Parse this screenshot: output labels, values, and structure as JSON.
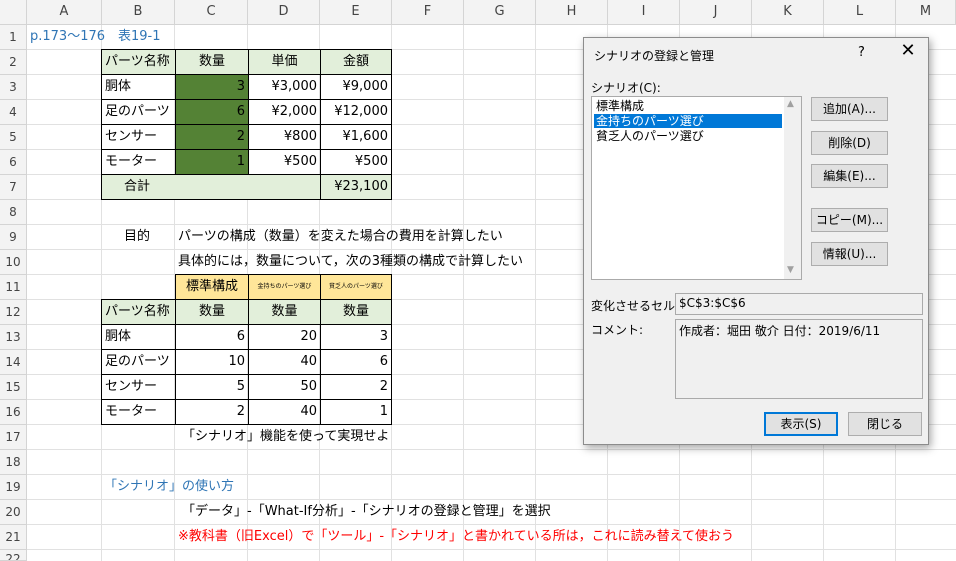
{
  "columns": [
    "A",
    "B",
    "C",
    "D",
    "E",
    "F",
    "G",
    "H",
    "I",
    "J",
    "K",
    "L",
    "M"
  ],
  "rows": [
    "1",
    "2",
    "3",
    "4",
    "5",
    "6",
    "7",
    "8",
    "9",
    "10",
    "11",
    "12",
    "13",
    "14",
    "15",
    "16",
    "17",
    "18",
    "19",
    "20",
    "21",
    "22"
  ],
  "cells": {
    "title": "p.173～176　表19-1",
    "h_name": "パーツ名称",
    "h_qty": "数量",
    "h_unit": "単価",
    "h_amount": "金額",
    "parts": [
      {
        "name": "胴体",
        "qty": "3",
        "unit": "¥3,000",
        "amount": "¥9,000"
      },
      {
        "name": "足のパーツ",
        "qty": "6",
        "unit": "¥2,000",
        "amount": "¥12,000"
      },
      {
        "name": "センサー",
        "qty": "2",
        "unit": "¥800",
        "amount": "¥1,600"
      },
      {
        "name": "モーター",
        "qty": "1",
        "unit": "¥500",
        "amount": "¥500"
      }
    ],
    "total_label": "合計",
    "total_value": "¥23,100",
    "purpose_label": "目的",
    "purpose_text": "パーツの構成（数量）を変えた場合の費用を計算したい",
    "detail_text": "具体的には，数量について，次の3種類の構成で計算したい",
    "scen_std": "標準構成",
    "scen_rich": "金持ちのパーツ選び",
    "scen_poor": "貧乏人のパーツ選び",
    "scen_rows": [
      {
        "name": "胴体",
        "a": "6",
        "b": "20",
        "c": "3"
      },
      {
        "name": "足のパーツ",
        "a": "10",
        "b": "40",
        "c": "6"
      },
      {
        "name": "センサー",
        "a": "5",
        "b": "50",
        "c": "2"
      },
      {
        "name": "モーター",
        "a": "2",
        "b": "40",
        "c": "1"
      }
    ],
    "instruction": "「シナリオ」機能を使って実現せよ",
    "howto_title": "「シナリオ」の使い方",
    "howto_steps": "「データ」-「What-If分析」-「シナリオの登録と管理」を選択",
    "note": "※教科書（旧Excel）で「ツール」-「シナリオ」と書かれている所は，これに読み替えて使おう"
  },
  "dialog": {
    "title": "シナリオの登録と管理",
    "help": "?",
    "close": "✕",
    "scenario_label": "シナリオ(C):",
    "scenarios": [
      "標準構成",
      "金持ちのパーツ選び",
      "貧乏人のパーツ選び"
    ],
    "selected_index": 1,
    "btn_add": "追加(A)...",
    "btn_delete": "削除(D)",
    "btn_edit": "編集(E)...",
    "btn_copy": "コピー(M)...",
    "btn_info": "情報(U)...",
    "changing_label": "変化させるセル:",
    "changing_value": "$C$3:$C$6",
    "comment_label": "コメント:",
    "comment_value": "作成者：堀田 敬介 日付：2019/6/11",
    "btn_show": "表示(S)",
    "btn_close": "閉じる"
  },
  "colors": {
    "accent": "#0078d7",
    "header_fill": "#e2efda",
    "input_fill": "#548235",
    "scenario_fill": "#ffe699",
    "link_blue": "#2f75b5",
    "note_red": "#ff0000"
  }
}
